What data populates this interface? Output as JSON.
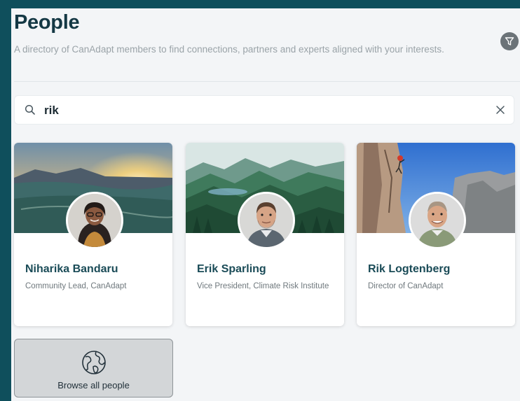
{
  "page": {
    "title": "People",
    "subtitle": "A directory of CanAdapt members to find connections, partners and experts aligned with your interests."
  },
  "search": {
    "value": "rik",
    "search_icon": "search-icon",
    "clear_icon": "close-icon"
  },
  "filter": {
    "icon": "filter-funnel-icon"
  },
  "people": [
    {
      "name": "Niharika Bandaru",
      "role": "Community Lead, CanAdapt",
      "cover": "sunrise-landscape",
      "avatar": "woman-with-glasses-photo"
    },
    {
      "name": "Erik Sparling",
      "role": "Vice President, Climate Risk Institute",
      "cover": "forested-mountains-illustration",
      "avatar": "man-portrait-photo"
    },
    {
      "name": "Rik Logtenberg",
      "role": "Director of CanAdapt",
      "cover": "rock-climbing-cliffs",
      "avatar": "man-portrait-photo"
    }
  ],
  "browse": {
    "label": "Browse all people",
    "icon": "globe-icon"
  },
  "colors": {
    "frame": "#0f4f5c",
    "panel": "#f3f5f7",
    "title": "#143844",
    "name": "#1a4b57"
  }
}
